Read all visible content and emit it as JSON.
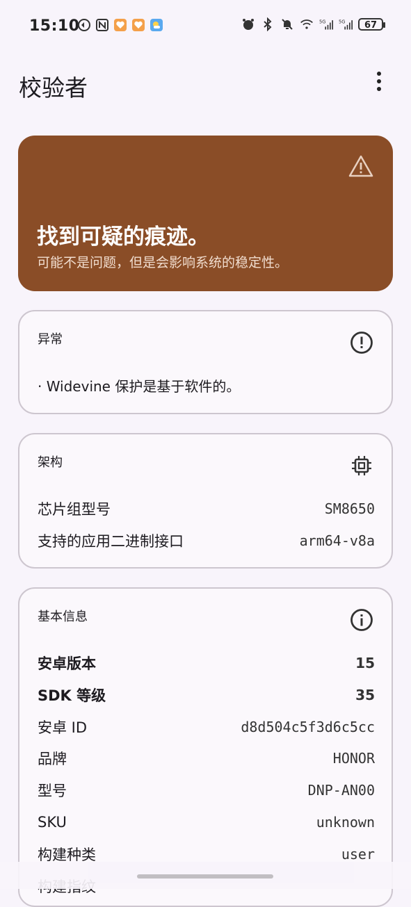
{
  "status_bar": {
    "time": "15:10",
    "battery": "67",
    "left_icons": [
      "vpn-icon",
      "nfc-icon",
      "app-notification-icon",
      "app-notification-icon",
      "weather-icon"
    ],
    "right_icons": [
      "alarm-icon",
      "bluetooth-icon",
      "mute-icon",
      "wifi-icon",
      "signal-5g-icon",
      "signal-5g-icon",
      "battery-icon"
    ]
  },
  "app_bar": {
    "title": "校验者",
    "menu_icon": "more-vert-icon"
  },
  "banner": {
    "title": "找到可疑的痕迹。",
    "subtitle": "可能不是问题，但是会影响系统的稳定性。",
    "icon": "warning-icon",
    "color": "#8a4d27"
  },
  "cards": {
    "anomaly": {
      "title": "异常",
      "icon": "error-outline-icon",
      "items": [
        "· Widevine 保护是基于软件的。"
      ]
    },
    "architecture": {
      "title": "架构",
      "icon": "chip-icon",
      "rows": [
        {
          "key": "芯片组型号",
          "value": "SM8650"
        },
        {
          "key": "支持的应用二进制接口",
          "value": "arm64-v8a"
        }
      ]
    },
    "basic_info": {
      "title": "基本信息",
      "icon": "info-icon",
      "rows": [
        {
          "key": "安卓版本",
          "value": "15"
        },
        {
          "key": "SDK 等级",
          "value": "35"
        },
        {
          "key": "安卓 ID",
          "value": "d8d504c5f3d6c5cc"
        },
        {
          "key": "品牌",
          "value": "HONOR"
        },
        {
          "key": "型号",
          "value": "DNP-AN00"
        },
        {
          "key": "SKU",
          "value": "unknown"
        },
        {
          "key": "构建种类",
          "value": "user"
        },
        {
          "key": "构建指纹",
          "value": ""
        }
      ]
    }
  }
}
